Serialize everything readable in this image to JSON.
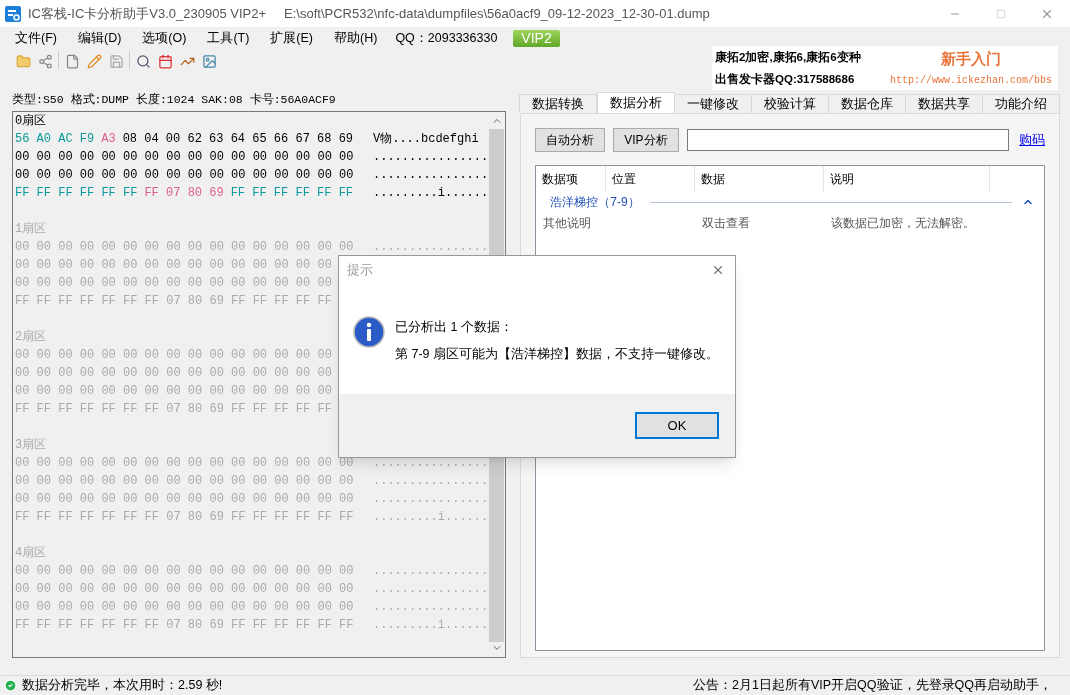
{
  "window": {
    "title": "IC客栈-IC卡分析助手V3.0_230905 VIP2+",
    "path": "E:\\soft\\PCR532\\nfc-data\\dumpfiles\\56a0acf9_09-12-2023_12-30-01.dump"
  },
  "menu": [
    {
      "label": "文件(F)"
    },
    {
      "label": "编辑(D)"
    },
    {
      "label": "选项(O)"
    },
    {
      "label": "工具(T)"
    },
    {
      "label": "扩展(E)"
    },
    {
      "label": "帮助(H)"
    }
  ],
  "qq": "QQ：2093336330",
  "vip_badge": "VIP2",
  "banner": {
    "line_1": "康拓2加密,康拓6,康拓6变种",
    "line_2": "出售发卡器QQ:317588686",
    "title": "新手入门",
    "url": "http://www.ickezhan.com/bbs"
  },
  "card_info": "类型:S50 格式:DUMP 长度:1024 SAK:08 卡号:56A0ACF9",
  "sectors": [
    {
      "label": "0扇区",
      "active": true,
      "rows": [
        {
          "segments": [
            {
              "kind": "key",
              "bytes": "56 A0 AC F9"
            },
            {
              "kind": "access",
              "bytes": "A3"
            },
            {
              "kind": "data",
              "bytes": "08 04 00 62 63 64 65 66 67 68 69"
            }
          ],
          "ascii": "V物....bcdefghi"
        },
        {
          "segments": [
            {
              "kind": "data",
              "bytes": "00 00 00 00 00 00 00 00 00 00 00 00 00 00 00 00"
            }
          ],
          "ascii": "................"
        },
        {
          "segments": [
            {
              "kind": "data",
              "bytes": "00 00 00 00 00 00 00 00 00 00 00 00 00 00 00 00"
            }
          ],
          "ascii": "................"
        },
        {
          "segments": [
            {
              "kind": "key",
              "bytes": "FF FF FF FF FF FF"
            },
            {
              "kind": "access",
              "bytes": "FF 07 80 69"
            },
            {
              "kind": "key",
              "bytes": "FF FF FF FF FF FF"
            }
          ],
          "ascii": ".........i......"
        }
      ]
    },
    {
      "label": "1扇区",
      "active": false,
      "rows": [
        {
          "segments": [
            {
              "kind": "data",
              "bytes": "00 00 00 00 00 00 00 00 00 00 00 00 00 00 00 00"
            }
          ],
          "ascii": "................"
        },
        {
          "segments": [
            {
              "kind": "data",
              "bytes": "00 00 00 00 00 00 00 00 00 00 00 00 00 00 00"
            }
          ]
        },
        {
          "segments": [
            {
              "kind": "data",
              "bytes": "00 00 00 00 00 00 00 00 00 00 00 00 00 00 00"
            }
          ]
        },
        {
          "segments": [
            {
              "kind": "data",
              "bytes": "FF FF FF FF FF FF FF 07 80 69 FF FF FF FF FF"
            }
          ]
        }
      ]
    },
    {
      "label": "2扇区",
      "active": false,
      "rows": [
        {
          "segments": [
            {
              "kind": "data",
              "bytes": "00 00 00 00 00 00 00 00 00 00 00 00 00 00 00"
            }
          ]
        },
        {
          "segments": [
            {
              "kind": "data",
              "bytes": "00 00 00 00 00 00 00 00 00 00 00 00 00 00 00"
            }
          ]
        },
        {
          "segments": [
            {
              "kind": "data",
              "bytes": "00 00 00 00 00 00 00 00 00 00 00 00 00 00 00"
            }
          ]
        },
        {
          "segments": [
            {
              "kind": "data",
              "bytes": "FF FF FF FF FF FF FF 07 80 69 FF FF FF FF FF"
            }
          ]
        }
      ]
    },
    {
      "label": "3扇区",
      "active": false,
      "rows": [
        {
          "segments": [
            {
              "kind": "data",
              "bytes": "00 00 00 00 00 00 00 00 00 00 00 00 00 00 00 00"
            }
          ],
          "ascii": "................"
        },
        {
          "segments": [
            {
              "kind": "data",
              "bytes": "00 00 00 00 00 00 00 00 00 00 00 00 00 00 00 00"
            }
          ],
          "ascii": "................"
        },
        {
          "segments": [
            {
              "kind": "data",
              "bytes": "00 00 00 00 00 00 00 00 00 00 00 00 00 00 00 00"
            }
          ],
          "ascii": "................"
        },
        {
          "segments": [
            {
              "kind": "data",
              "bytes": "FF FF FF FF FF FF FF 07 80 69 FF FF FF FF FF FF"
            }
          ],
          "ascii": ".........i......"
        }
      ]
    },
    {
      "label": "4扇区",
      "active": false,
      "rows": [
        {
          "segments": [
            {
              "kind": "data",
              "bytes": "00 00 00 00 00 00 00 00 00 00 00 00 00 00 00 00"
            }
          ],
          "ascii": "................"
        },
        {
          "segments": [
            {
              "kind": "data",
              "bytes": "00 00 00 00 00 00 00 00 00 00 00 00 00 00 00 00"
            }
          ],
          "ascii": "................"
        },
        {
          "segments": [
            {
              "kind": "data",
              "bytes": "00 00 00 00 00 00 00 00 00 00 00 00 00 00 00 00"
            }
          ],
          "ascii": "................"
        },
        {
          "segments": [
            {
              "kind": "data",
              "bytes": "FF FF FF FF FF FF FF 07 80 69 FF FF FF FF FF FF"
            }
          ],
          "ascii": ".........i......"
        }
      ]
    }
  ],
  "tabs": [
    {
      "label": "数据转换",
      "selected": false
    },
    {
      "label": "数据分析",
      "selected": true
    },
    {
      "label": "一键修改",
      "selected": false
    },
    {
      "label": "校验计算",
      "selected": false
    },
    {
      "label": "数据仓库",
      "selected": false
    },
    {
      "label": "数据共享",
      "selected": false
    },
    {
      "label": "功能介绍",
      "selected": false
    }
  ],
  "analysis": {
    "buttons": [
      "自动分析",
      "VIP分析"
    ],
    "link": "购码",
    "table": {
      "columns": [
        "数据项",
        "位置",
        "数据",
        "说明"
      ],
      "groups": [
        {
          "label": "浩洋梯控（7-9）",
          "expanded": true,
          "rows": [
            [
              "其他说明",
              "",
              "双击查看",
              "该数据已加密，无法解密。"
            ]
          ]
        }
      ]
    }
  },
  "status_bar": {
    "message": "数据分析完毕，本次用时：2.59 秒!",
    "notice": "公告：2月1日起所有VIP开启QQ验证，先登录QQ再启动助手，"
  },
  "dialog": {
    "title": "提示",
    "lines": [
      "已分析出 1 个数据：",
      "第 7-9 扇区可能为【浩洋梯控】数据，不支持一键修改。"
    ],
    "button": "OK"
  }
}
